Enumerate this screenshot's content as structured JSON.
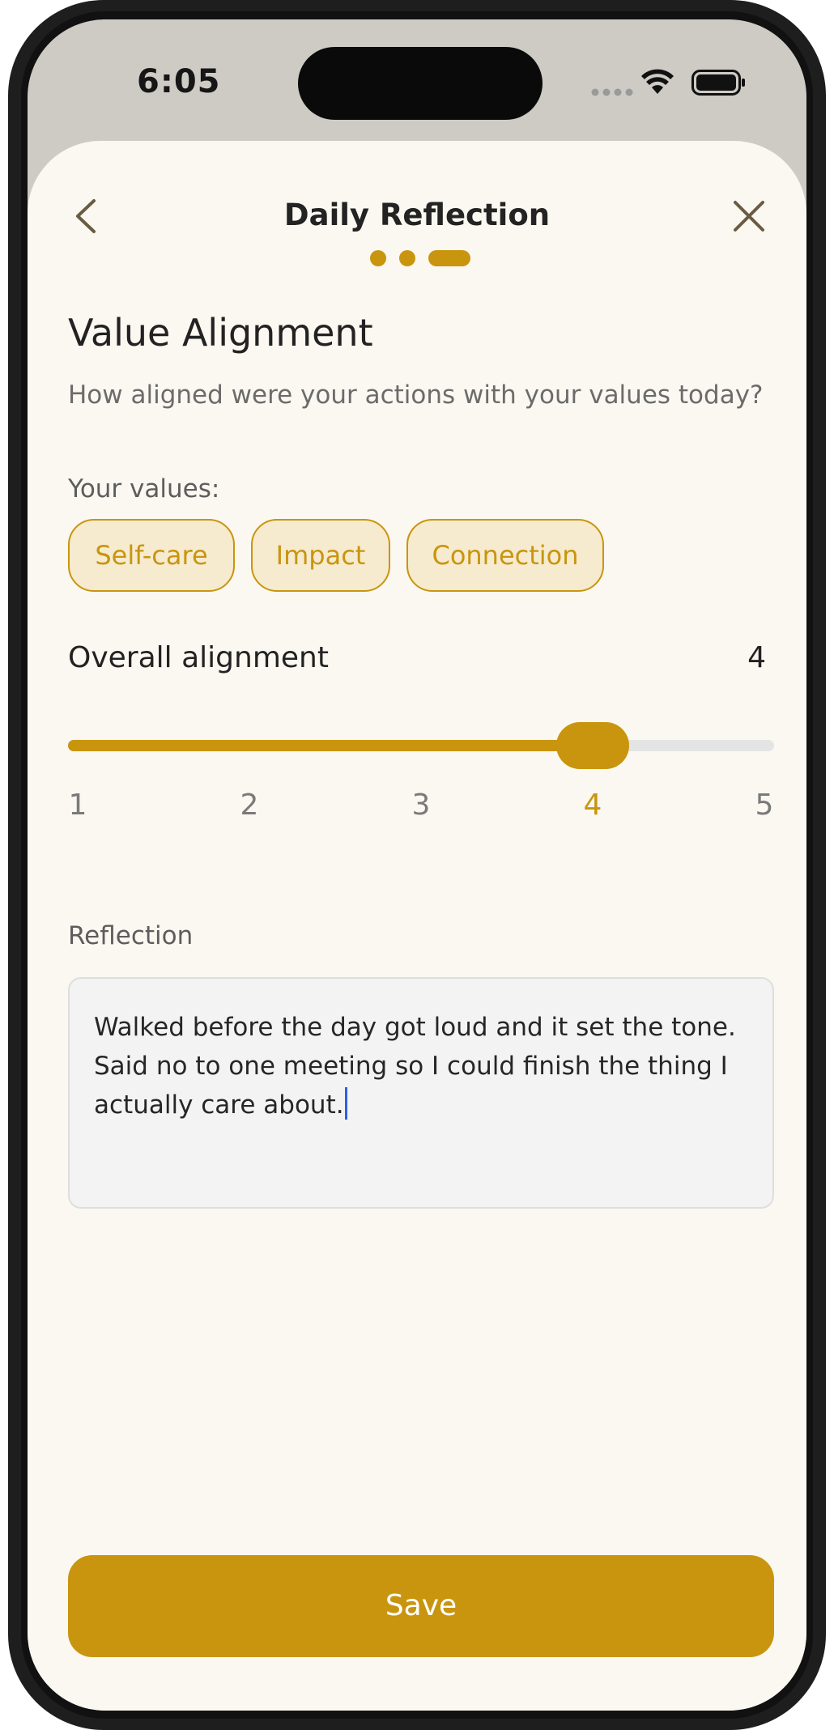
{
  "status_bar": {
    "time": "6:05"
  },
  "header": {
    "title": "Daily Reflection",
    "steps_total": 3,
    "current_step": 3,
    "back_icon": "chevron-left-icon",
    "close_icon": "close-icon"
  },
  "section": {
    "title": "Value Alignment",
    "prompt": "How aligned were your actions with your values today?"
  },
  "values": {
    "label": "Your values:",
    "chips": [
      "Self-care",
      "Impact",
      "Connection"
    ]
  },
  "alignment": {
    "label": "Overall alignment",
    "value": "4",
    "min": 1,
    "max": 5,
    "ticks": [
      "1",
      "2",
      "3",
      "4",
      "5"
    ]
  },
  "reflection": {
    "label": "Reflection",
    "text": "Walked before the day got loud and it set the tone. Said no to one meeting so I could finish the thing I actually care about."
  },
  "save_button": {
    "label": "Save"
  },
  "colors": {
    "accent": "#c9950f",
    "sheet_background": "#fbf8f1",
    "chip_background": "#f6ebcf",
    "caret": "#2f5fe0"
  }
}
